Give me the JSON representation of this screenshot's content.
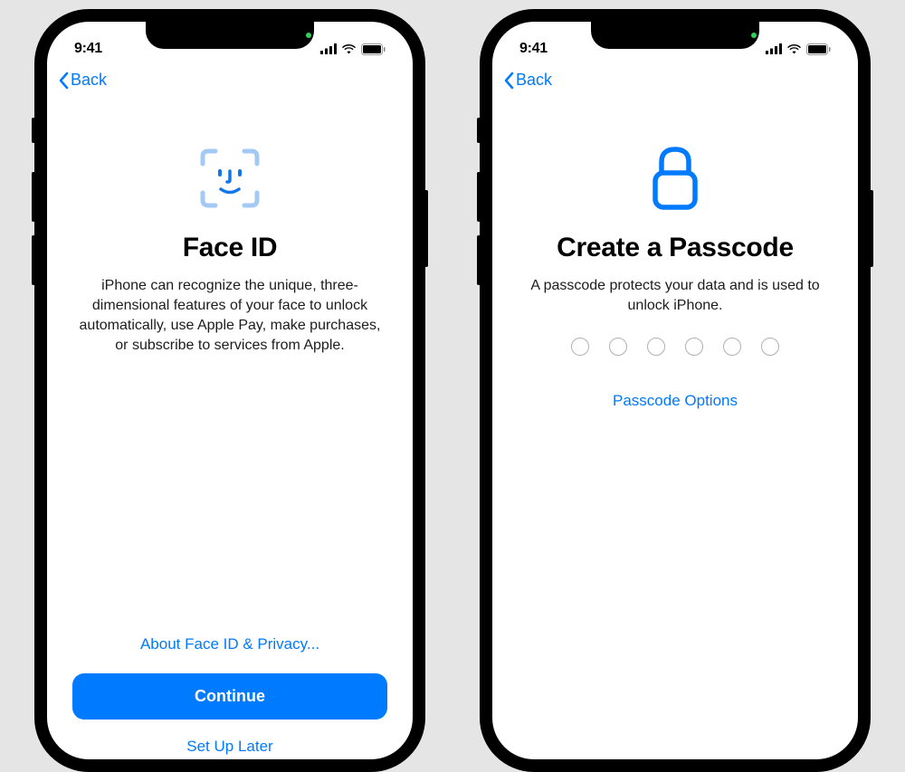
{
  "statusBar": {
    "time": "9:41"
  },
  "nav": {
    "back": "Back"
  },
  "left": {
    "title": "Face ID",
    "description": "iPhone can recognize the unique, three-dimensional features of your face to unlock automatically, use Apple Pay, make purchases, or subscribe to services from Apple.",
    "aboutLink": "About Face ID & Privacy...",
    "continueBtn": "Continue",
    "setupLater": "Set Up Later"
  },
  "right": {
    "title": "Create a Passcode",
    "description": "A passcode protects your data and is used to unlock iPhone.",
    "optionsLink": "Passcode Options"
  },
  "colors": {
    "accent": "#007aff"
  }
}
